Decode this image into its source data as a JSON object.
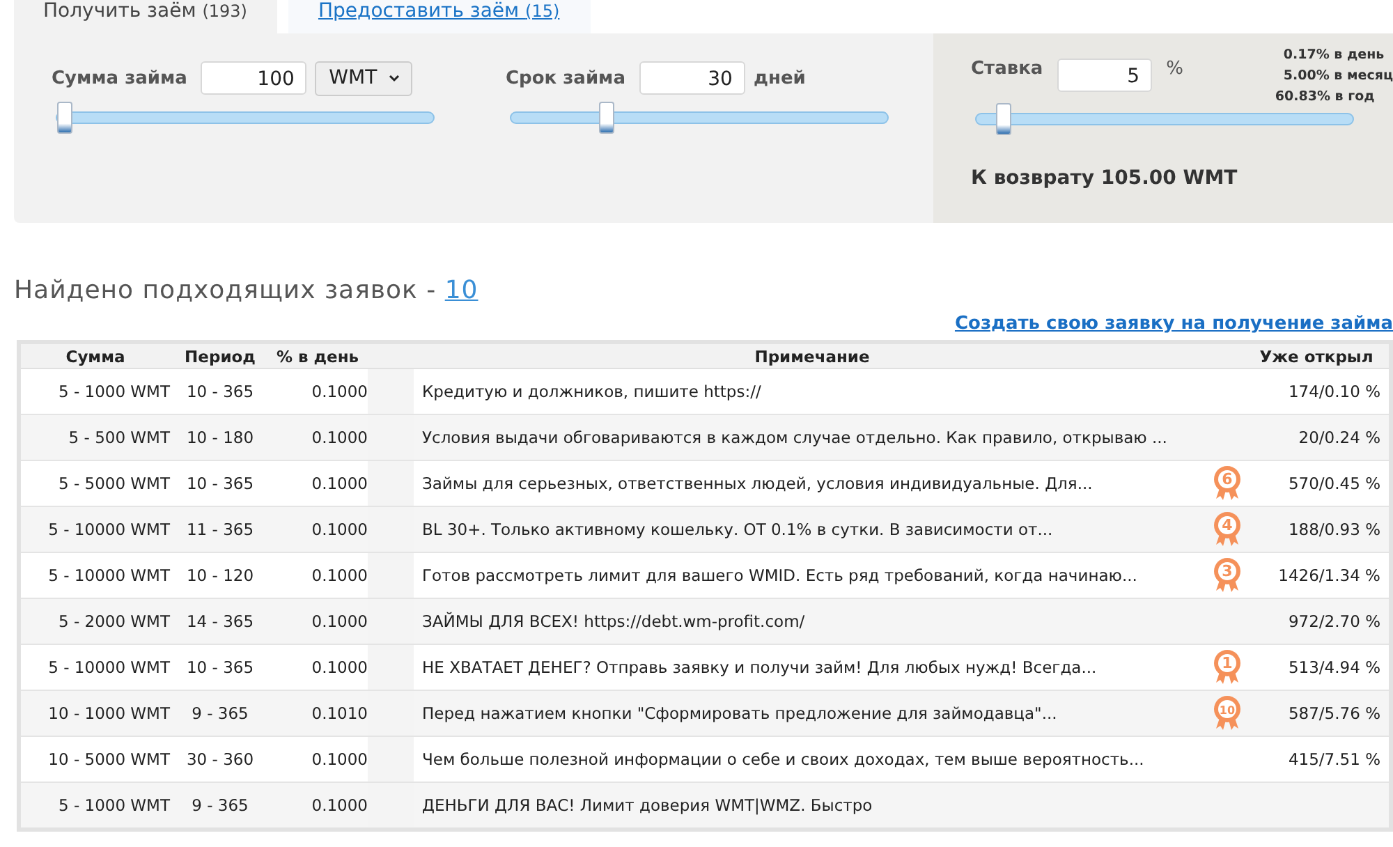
{
  "tabs": [
    {
      "label": "Получить заём",
      "count": "(193)",
      "selected": true
    },
    {
      "label": "Предоставить заём",
      "count": "(15)",
      "selected": false
    }
  ],
  "filters": {
    "amount": {
      "label": "Сумма займа",
      "value": "100",
      "currency": "WMT",
      "level": 0.02
    },
    "term": {
      "label": "Срок займа",
      "value": "30",
      "unit": "дней",
      "level": 0.25
    },
    "rate": {
      "label": "Ставка",
      "value": "5",
      "unit": "%",
      "level": 0.07,
      "rates": [
        "0.17% в день",
        "5.00% в месяц",
        "60.83% в год"
      ],
      "return_text": "К возврату 105.00 WMT"
    }
  },
  "results": {
    "title": "Найдено подходящих заявок -",
    "count": "10",
    "create_link": "Создать свою заявку на получение займа"
  },
  "table": {
    "columns": [
      "Сумма",
      "Период",
      "% в день",
      "Примечание",
      "Уже открыл"
    ],
    "rows": [
      {
        "amount": "5 - 1000 WMT",
        "period": "10 - 365",
        "rate": "0.1000",
        "note": "Кредитую и должников, пишите https://",
        "opened": "174/0.10 %"
      },
      {
        "amount": "5 - 500 WMT",
        "period": "10 - 180",
        "rate": "0.1000",
        "note": "Условия выдачи обговариваются в каждом случае отдельно. Как правило, открываю ...",
        "opened": "20/0.24 %"
      },
      {
        "amount": "5 - 5000 WMT",
        "period": "10 - 365",
        "rate": "0.1000",
        "note": "Займы для серьезных, ответственных людей, условия индивидуальные. Для...",
        "badge": "6",
        "opened": "570/0.45 %"
      },
      {
        "amount": "5 - 10000 WMT",
        "period": "11 - 365",
        "rate": "0.1000",
        "note": "BL 30+. Только активному кошельку. ОТ 0.1% в сутки. В зависимости от...",
        "badge": "4",
        "opened": "188/0.93 %"
      },
      {
        "amount": "5 - 10000 WMT",
        "period": "10 - 120",
        "rate": "0.1000",
        "note": "Готов рассмотреть лимит для вашего WMID. Есть ряд требований, когда начинаю...",
        "badge": "3",
        "opened": "1426/1.34 %"
      },
      {
        "amount": "5 - 2000 WMT",
        "period": "14 - 365",
        "rate": "0.1000",
        "note": "ЗАЙМЫ ДЛЯ ВСЕХ! https://debt.wm-profit.com/",
        "opened": "972/2.70 %"
      },
      {
        "amount": "5 - 10000 WMT",
        "period": "10 - 365",
        "rate": "0.1000",
        "note": "НЕ ХВАТАЕТ ДЕНЕГ? Отправь заявку и получи займ! Для любых нужд! Всегда...",
        "badge": "1",
        "opened": "513/4.94 %"
      },
      {
        "amount": "10 - 1000 WMT",
        "period": "9 - 365",
        "rate": "0.1010",
        "note": "Перед нажатием кнопки \"Сформировать предложение для займодавца\"...",
        "badge": "10",
        "opened": "587/5.76 %"
      },
      {
        "amount": "10 - 5000 WMT",
        "period": "30 - 360",
        "rate": "0.1000",
        "note": "Чем больше полезной информации о себе и своих доходах, тем выше вероятность...",
        "opened": "415/7.51 %"
      },
      {
        "amount": "5 - 1000 WMT",
        "period": "9 - 365",
        "rate": "0.1000",
        "note": "ДЕНЬГИ ДЛЯ ВАС! Лимит доверия WMT|WMZ. Быстро",
        "opened": ""
      }
    ]
  }
}
